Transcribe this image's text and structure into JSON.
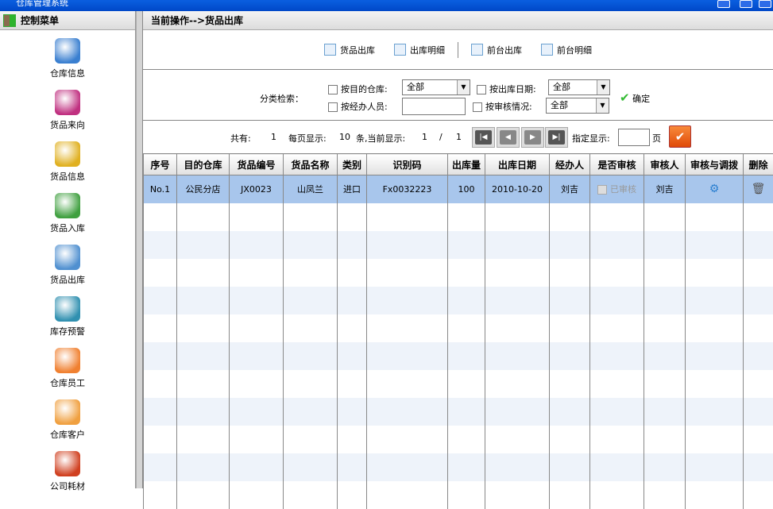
{
  "window": {
    "title": "仓库管理系统"
  },
  "sidebar": {
    "title": "控制菜单",
    "items": [
      {
        "label": "仓库信息",
        "color": "#3a7fd0"
      },
      {
        "label": "货品来向",
        "color": "#c03080"
      },
      {
        "label": "货品信息",
        "color": "#e0b020"
      },
      {
        "label": "货品入库",
        "color": "#40a040"
      },
      {
        "label": "货品出库",
        "color": "#5090d0"
      },
      {
        "label": "库存预警",
        "color": "#3090b0"
      },
      {
        "label": "仓库员工",
        "color": "#f08030"
      },
      {
        "label": "仓库客户",
        "color": "#f0a040"
      },
      {
        "label": "公司耗材",
        "color": "#d04020"
      }
    ]
  },
  "main": {
    "breadcrumb": "当前操作-->货品出库",
    "toolbar": [
      "货品出库",
      "出库明细",
      "前台出库",
      "前台明细"
    ],
    "filter": {
      "label": "分类检索：",
      "by_warehouse": "按目的仓库:",
      "by_date": "按出库日期:",
      "by_handler": "按经办人员:",
      "by_audit": "按审核情况:",
      "warehouse_value": "全部",
      "date_value": "全部",
      "audit_value": "全部",
      "handler_value": "",
      "confirm": "确定"
    },
    "pager": {
      "total_label": "共有:",
      "total": "1",
      "per_page_label": "每页显示:",
      "per_page": "10",
      "current_label": "条,当前显示:",
      "current": "1",
      "sep": "/",
      "pages": "1",
      "goto_label": "指定显示:",
      "page_unit": "页"
    },
    "table": {
      "headers": [
        "序号",
        "目的仓库",
        "货品编号",
        "货品名称",
        "类别",
        "识别码",
        "出库量",
        "出库日期",
        "经办人",
        "是否审核",
        "审核人",
        "审核与调拨",
        "删除"
      ],
      "rows": [
        {
          "no": "No.1",
          "warehouse": "公民分店",
          "code": "JX0023",
          "name": "山凤兰",
          "type": "进口",
          "id": "Fx0032223",
          "qty": "100",
          "date": "2010-10-20",
          "handler": "刘吉",
          "audited": "已审核",
          "auditor": "刘吉"
        }
      ]
    }
  }
}
